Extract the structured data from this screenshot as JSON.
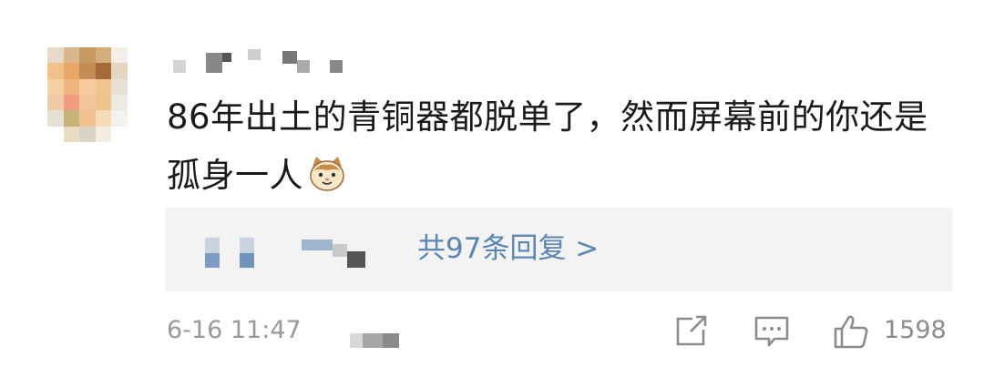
{
  "comment": {
    "text": "86年出土的青铜器都脱单了，然而屏幕前的你还是孤身一人",
    "emoji_icon": "cat-face-emoji-icon"
  },
  "replies": {
    "link_label": "共97条回复 >"
  },
  "footer": {
    "time": "6-16 11:47",
    "like_count": "1598"
  },
  "colors": {
    "text": "#1a1a1a",
    "link": "#5a86b3",
    "muted": "#9a9a9a",
    "reply_bg": "#f3f3f3"
  },
  "icons": [
    "share-icon",
    "comment-icon",
    "like-thumb-icon"
  ]
}
